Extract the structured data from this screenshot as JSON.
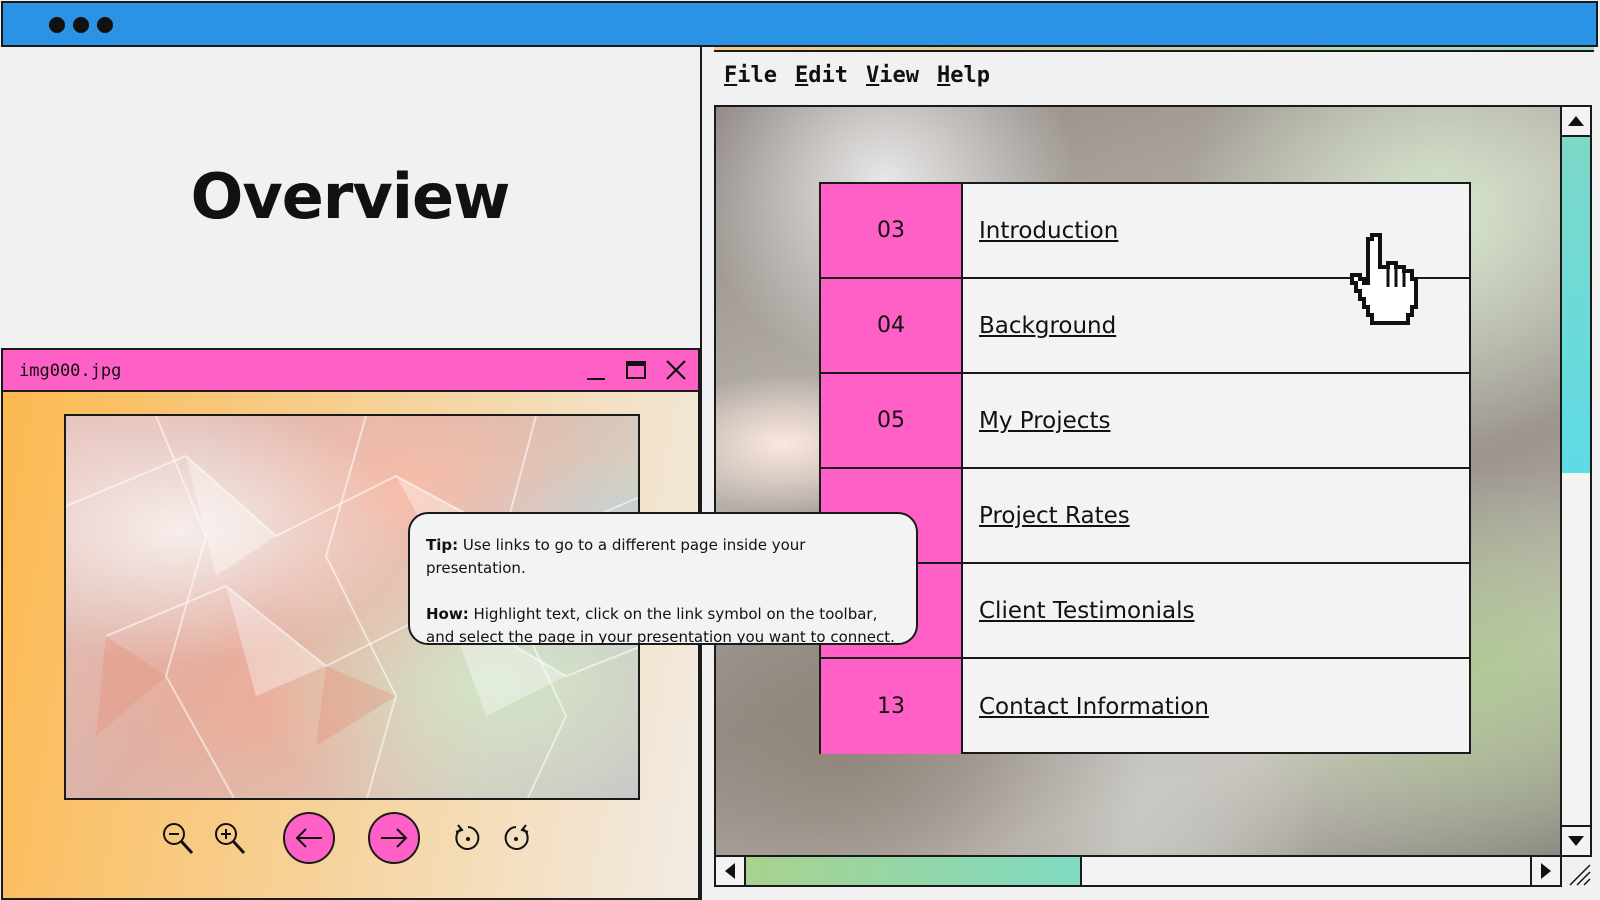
{
  "overview": {
    "title": "Overview"
  },
  "viewer": {
    "title": "img000.jpg",
    "tools": [
      "zoom-out",
      "zoom-in",
      "previous",
      "next",
      "rotate-left",
      "rotate-right"
    ]
  },
  "tooltip": {
    "tip_label": "Tip:",
    "tip_text": " Use links to go to a different page inside your presentation.",
    "how_label": "How:",
    "how_text": " Highlight text, click on the link symbol on the toolbar, and select the page in your presentation  you want to connect."
  },
  "menubar": {
    "file": "File",
    "edit": "Edit",
    "view": "View",
    "help": "Help"
  },
  "toc": {
    "rows": [
      {
        "number": "03",
        "label": "Introduction"
      },
      {
        "number": "04",
        "label": "Background"
      },
      {
        "number": "05",
        "label": "My Projects"
      },
      {
        "number": "",
        "label": "Project Rates"
      },
      {
        "number": "",
        "label": "Client Testimonials"
      },
      {
        "number": "13",
        "label": "Contact Information"
      }
    ]
  },
  "colors": {
    "topbar": "#2b93e6",
    "accent_pink": "#ff60c6",
    "scroll_teal": "#5fdbe6"
  },
  "icons": [
    "window-dots-icon",
    "minimize-icon",
    "maximize-icon",
    "close-icon",
    "hand-cursor-icon",
    "arrow-up-icon",
    "arrow-down-icon",
    "arrow-left-icon",
    "arrow-right-icon",
    "resize-grip-icon"
  ]
}
